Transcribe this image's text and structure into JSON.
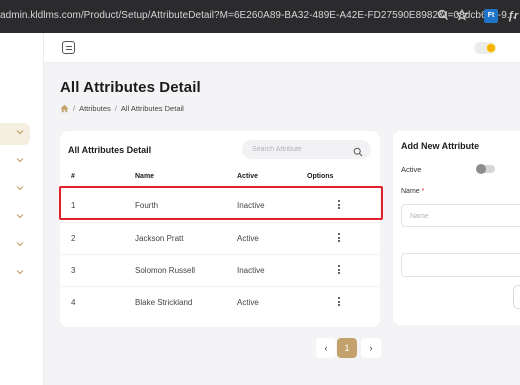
{
  "browser": {
    "url": "admin.kldlms.com/Product/Setup/AttributeDetail?M=6E260A89-BA32-489E-A42E-FD27590E8982&I=08dcb6d2-9...",
    "ext_badge": "Ft",
    "ext_more": "ƒr"
  },
  "page": {
    "title": "All Attributes Detail"
  },
  "breadcrumb": {
    "items": [
      "Attributes",
      "All Attributes Detail"
    ],
    "separator": "/"
  },
  "table_card": {
    "title": "All Attributes Detail",
    "search_placeholder": "Search Attribute",
    "columns": [
      "#",
      "Name",
      "Active",
      "Options"
    ],
    "rows": [
      {
        "num": "1",
        "name": "Fourth",
        "active": "Inactive"
      },
      {
        "num": "2",
        "name": "Jackson Pratt",
        "active": "Active"
      },
      {
        "num": "3",
        "name": "Solomon Russell",
        "active": "Inactive"
      },
      {
        "num": "4",
        "name": "Blake Strickland",
        "active": "Active"
      }
    ]
  },
  "pagination": {
    "prev": "‹",
    "current": "1",
    "next": "›"
  },
  "add_card": {
    "title": "Add New Attribute",
    "active_label": "Active",
    "name_label": "Name",
    "required_mark": "*",
    "name_placeholder": "Name"
  },
  "colors": {
    "accent": "#c4a26d",
    "highlight_border": "#e0202a",
    "background": "#f4f4f6"
  }
}
